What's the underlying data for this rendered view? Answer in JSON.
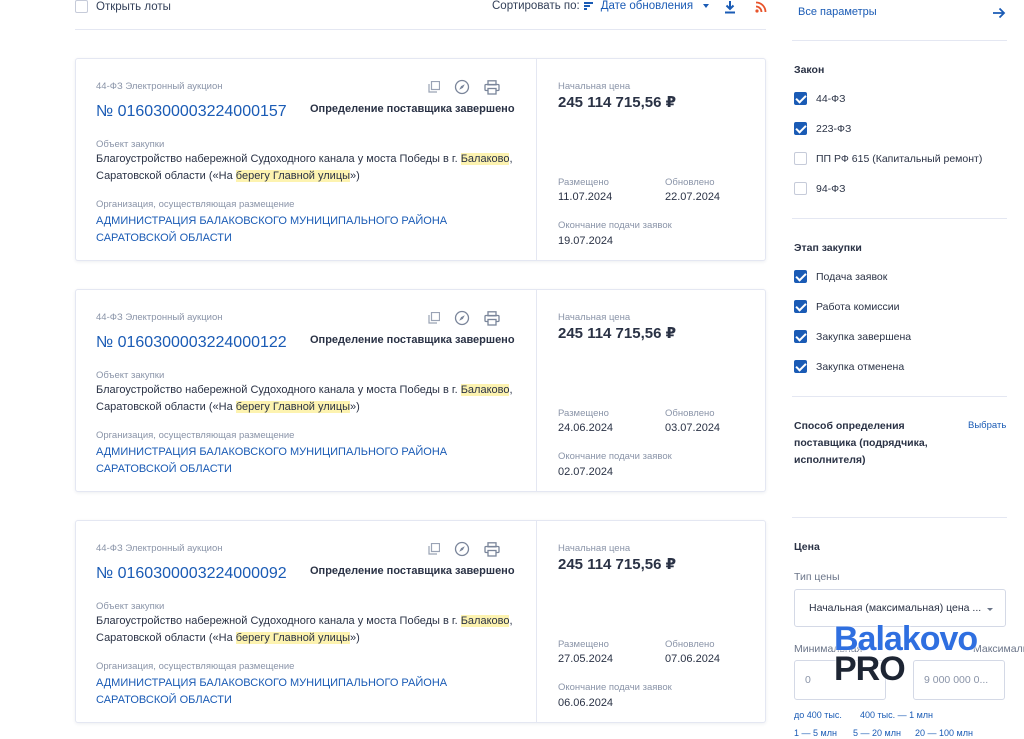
{
  "toolbar": {
    "open_lots": "Открыть лоты",
    "sort_label": "Сортировать по:",
    "sort_value": "Дате обновления",
    "icons": [
      "download-icon",
      "rss-icon"
    ]
  },
  "cards": [
    {
      "type": "44-ФЗ Электронный аукцион",
      "number": "№ 0160300003224000157",
      "status": "Определение поставщика завершено",
      "object_label": "Объект закупки",
      "object_parts": [
        "Благоустройство набережной Судоходного канала у моста Победы в г. ",
        "Балаково",
        ", Саратовской области («На ",
        "берегу Главной улицы",
        "»)"
      ],
      "org_label": "Организация, осуществляющая размещение",
      "org": "АДМИНИСТРАЦИЯ БАЛАКОВСКОГО МУНИЦИПАЛЬНОГО РАЙОНА САРАТОВСКОЙ ОБЛАСТИ",
      "price_label": "Начальная цена",
      "price": "245 114 715,56 ₽",
      "placed_label": "Размещено",
      "placed": "11.07.2024",
      "updated_label": "Обновлено",
      "updated": "22.07.2024",
      "end_label": "Окончание подачи заявок",
      "end": "19.07.2024"
    },
    {
      "type": "44-ФЗ Электронный аукцион",
      "number": "№ 0160300003224000122",
      "status": "Определение поставщика завершено",
      "object_label": "Объект закупки",
      "object_parts": [
        "Благоустройство набережной Судоходного канала у моста Победы в г. ",
        "Балаково",
        ", Саратовской области («На ",
        "берегу Главной улицы",
        "»)"
      ],
      "org_label": "Организация, осуществляющая размещение",
      "org": "АДМИНИСТРАЦИЯ БАЛАКОВСКОГО МУНИЦИПАЛЬНОГО РАЙОНА САРАТОВСКОЙ ОБЛАСТИ",
      "price_label": "Начальная цена",
      "price": "245 114 715,56 ₽",
      "placed_label": "Размещено",
      "placed": "24.06.2024",
      "updated_label": "Обновлено",
      "updated": "03.07.2024",
      "end_label": "Окончание подачи заявок",
      "end": "02.07.2024"
    },
    {
      "type": "44-ФЗ Электронный аукцион",
      "number": "№ 0160300003224000092",
      "status": "Определение поставщика завершено",
      "object_label": "Объект закупки",
      "object_parts": [
        "Благоустройство набережной Судоходного канала у моста Победы в г. ",
        "Балаково",
        ", Саратовской области («На ",
        "берегу Главной улицы",
        "»)"
      ],
      "org_label": "Организация, осуществляющая размещение",
      "org": "АДМИНИСТРАЦИЯ БАЛАКОВСКОГО МУНИЦИПАЛЬНОГО РАЙОНА САРАТОВСКОЙ ОБЛАСТИ",
      "price_label": "Начальная цена",
      "price": "245 114 715,56 ₽",
      "placed_label": "Размещено",
      "placed": "27.05.2024",
      "updated_label": "Обновлено",
      "updated": "07.06.2024",
      "end_label": "Окончание подачи заявок",
      "end": "06.06.2024"
    }
  ],
  "card_icons": [
    "copy-icon",
    "compass-icon",
    "print-icon"
  ],
  "sidebar": {
    "all_params": "Все параметры",
    "law": {
      "title": "Закон",
      "items": [
        {
          "label": "44-ФЗ",
          "checked": true
        },
        {
          "label": "223-ФЗ",
          "checked": true
        },
        {
          "label": "ПП РФ 615 (Капитальный ремонт)",
          "checked": false
        },
        {
          "label": "94-ФЗ",
          "checked": false
        }
      ]
    },
    "stage": {
      "title": "Этап закупки",
      "items": [
        {
          "label": "Подача заявок",
          "checked": true
        },
        {
          "label": "Работа комиссии",
          "checked": true
        },
        {
          "label": "Закупка завершена",
          "checked": true
        },
        {
          "label": "Закупка отменена",
          "checked": true
        }
      ]
    },
    "method": {
      "title": "Способ определения поставщика (подрядчика, исполнителя)",
      "choose": "Выбрать"
    },
    "price": {
      "title": "Цена",
      "type_label": "Тип цены",
      "type_value": "Начальная (максимальная) цена ...",
      "min_label": "Минимальная",
      "max_label": "Максимальная",
      "min_placeholder": "0",
      "max_placeholder": "9 000 000 0...",
      "chips": [
        "до 400 тыс.",
        "400 тыс. — 1 млн",
        "1 — 5 млн",
        "5 — 20 млн",
        "20 — 100 млн"
      ]
    }
  },
  "watermark": {
    "line1": "Balakovo",
    "line2": "PRO"
  },
  "colors": {
    "accent": "#1a5bb5",
    "highlight": "#fdf3b0",
    "border": "#e4e7f2"
  }
}
